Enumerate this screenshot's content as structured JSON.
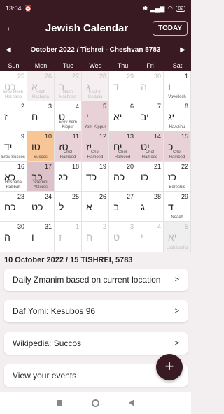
{
  "status": {
    "time": "13:04",
    "battery": "82"
  },
  "appbar": {
    "title": "Jewish Calendar",
    "today_label": "TODAY"
  },
  "month": {
    "title": "October 2022 / Tishrei - Cheshvan 5783"
  },
  "weekdays": [
    "Sun",
    "Mon",
    "Tue",
    "Wed",
    "Thu",
    "Fri",
    "Sat"
  ],
  "cells": [
    {
      "num": "25",
      "heb": "כט",
      "ev": "Erev Rosh Hashana",
      "style": "faded"
    },
    {
      "num": "26",
      "heb": "א",
      "ev": "Rosh Hashana",
      "style": "faded pink"
    },
    {
      "num": "27",
      "heb": "ב",
      "ev": "Rosh Hashana",
      "style": "faded pink"
    },
    {
      "num": "28",
      "heb": "ג",
      "ev": "Fast of Gedalia",
      "style": "faded pink"
    },
    {
      "num": "29",
      "heb": "ד",
      "ev": "",
      "style": "faded"
    },
    {
      "num": "30",
      "heb": "ה",
      "ev": "",
      "style": "faded"
    },
    {
      "num": "1",
      "heb": "ו",
      "ev": "Vayeilech",
      "style": ""
    },
    {
      "num": "2",
      "heb": "ז",
      "ev": "",
      "style": ""
    },
    {
      "num": "3",
      "heb": "ח",
      "ev": "",
      "style": ""
    },
    {
      "num": "4",
      "heb": "ט",
      "ev": "Erev Yom Kippur",
      "style": ""
    },
    {
      "num": "5",
      "heb": "י",
      "ev": "Yom Kippur",
      "style": "pink"
    },
    {
      "num": "6",
      "heb": "יא",
      "ev": "",
      "style": ""
    },
    {
      "num": "7",
      "heb": "יב",
      "ev": "",
      "style": ""
    },
    {
      "num": "8",
      "heb": "יג",
      "ev": "HaAzinu",
      "style": ""
    },
    {
      "num": "9",
      "heb": "יד",
      "ev": "Erev Succos",
      "style": ""
    },
    {
      "num": "10",
      "heb": "טו",
      "ev": "Succos",
      "style": "today"
    },
    {
      "num": "11",
      "heb": "טז",
      "ev": "Chol Hamoed",
      "style": "pink"
    },
    {
      "num": "12",
      "heb": "יז",
      "ev": "Chol Hamoed",
      "style": "pink"
    },
    {
      "num": "13",
      "heb": "יח",
      "ev": "Chol Hamoed",
      "style": "pink"
    },
    {
      "num": "14",
      "heb": "יט",
      "ev": "Chol Hamoed",
      "style": "pink"
    },
    {
      "num": "15",
      "heb": "כ",
      "ev": "Chol Hamoed",
      "style": "pink"
    },
    {
      "num": "16",
      "heb": "כא",
      "ev": "Hoshana Rabbah",
      "style": ""
    },
    {
      "num": "17",
      "heb": "כב",
      "ev": "Shemini Atzeres",
      "style": "darkpink"
    },
    {
      "num": "18",
      "heb": "כג",
      "ev": "",
      "style": ""
    },
    {
      "num": "19",
      "heb": "כד",
      "ev": "",
      "style": ""
    },
    {
      "num": "20",
      "heb": "כה",
      "ev": "",
      "style": ""
    },
    {
      "num": "21",
      "heb": "כו",
      "ev": "",
      "style": ""
    },
    {
      "num": "22",
      "heb": "כז",
      "ev": "Bereshis",
      "style": ""
    },
    {
      "num": "23",
      "heb": "כח",
      "ev": "",
      "style": ""
    },
    {
      "num": "24",
      "heb": "כט",
      "ev": "",
      "style": ""
    },
    {
      "num": "25",
      "heb": "ל",
      "ev": "",
      "style": ""
    },
    {
      "num": "26",
      "heb": "א",
      "ev": "",
      "style": ""
    },
    {
      "num": "27",
      "heb": "ב",
      "ev": "",
      "style": ""
    },
    {
      "num": "28",
      "heb": "ג",
      "ev": "",
      "style": ""
    },
    {
      "num": "29",
      "heb": "ד",
      "ev": "Noach",
      "style": ""
    },
    {
      "num": "30",
      "heb": "ה",
      "ev": "",
      "style": ""
    },
    {
      "num": "31",
      "heb": "ו",
      "ev": "",
      "style": ""
    },
    {
      "num": "1",
      "heb": "ז",
      "ev": "",
      "style": "faded"
    },
    {
      "num": "2",
      "heb": "ח",
      "ev": "",
      "style": "faded"
    },
    {
      "num": "3",
      "heb": "ט",
      "ev": "",
      "style": "faded"
    },
    {
      "num": "4",
      "heb": "י",
      "ev": "",
      "style": "faded"
    },
    {
      "num": "5",
      "heb": "יא",
      "ev": "Lech Lecha",
      "style": "faded grey"
    }
  ],
  "selected_date": "10 October 2022 / 15 TISHREI, 5783",
  "cards": [
    {
      "label": "Daily Zmanim based on current location"
    },
    {
      "label": "Daf Yomi: Kesubos 96"
    },
    {
      "label": "Wikipedia: Succos"
    },
    {
      "label": "View your events"
    }
  ]
}
